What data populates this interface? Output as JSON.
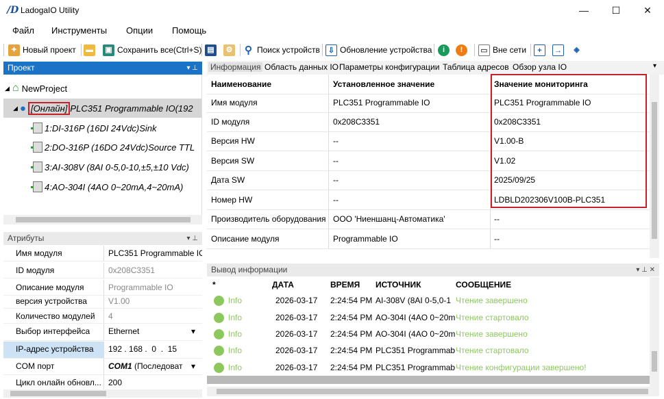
{
  "window": {
    "title": "LadogaIO Utility",
    "minimize": "—",
    "maximize": "☐",
    "close": "✕"
  },
  "menu": [
    "Файл",
    "Инструменты",
    "Опции",
    "Помощь"
  ],
  "toolbar": {
    "new_project": "Новый проект",
    "save_all": "Сохранить все(Ctrl+S)",
    "search_devices": "Поиск устройств",
    "update_device": "Обновление устройства",
    "offline": "Вне сети"
  },
  "project_panel": {
    "title": "Проект",
    "root": "NewProject",
    "plc_online": "[Онлайн]",
    "plc_name": "PLC351 Programmable IO(192",
    "modules": [
      "1:DI-316P (16DI 24Vdc)Sink",
      "2:DO-316P (16DO 24Vdc)Source TTL",
      "3:AI-308V (8AI 0-5,0-10,±5,±10 Vdc)",
      "4:AO-304I (4AO 0~20mA,4~20mA)"
    ]
  },
  "attributes_panel": {
    "title": "Атрибуты",
    "rows": [
      {
        "key": "Имя модуля",
        "value": "PLC351 Programmable IO"
      },
      {
        "key": "ID модуля",
        "value": "0x208C3351"
      },
      {
        "key": "Описание модуля",
        "value": "Programmable IO"
      },
      {
        "key": "версия устройства",
        "value": "V1.00"
      },
      {
        "key": "Количество модулей",
        "value": "4"
      },
      {
        "key": "Выбор интерфейса",
        "value": "Ethernet"
      },
      {
        "key": "IP-адрес устройства",
        "value": "192 . 168 .  0  .  15"
      },
      {
        "key": "COM порт",
        "value_bold": "COM1",
        "value": "(Последоват"
      },
      {
        "key": "Цикл онлайн обновл...",
        "value": "200"
      }
    ]
  },
  "tabs": [
    "Информация",
    "Область данных IO",
    "Параметры конфигурации",
    "Таблица адресов",
    "Обзор узла IO"
  ],
  "info_table": {
    "headers": [
      "Наименование",
      "Установленное значение",
      "Значение мониторинга"
    ],
    "rows": [
      [
        "Имя модуля",
        "PLC351 Programmable IO",
        "PLC351 Programmable IO"
      ],
      [
        "ID модуля",
        "0x208C3351",
        "0x208C3351"
      ],
      [
        "Версия HW",
        "--",
        "V1.00-B"
      ],
      [
        "Версия SW",
        "--",
        "V1.02"
      ],
      [
        "Дата SW",
        "--",
        "2025/09/25"
      ],
      [
        "Номер HW",
        "--",
        "LDBLD202306V100B-PLC351"
      ],
      [
        "Производитель оборудования",
        "ООО 'Ниеншанц-Автоматика'",
        "--"
      ],
      [
        "Описание модуля",
        "Programmable IO",
        "--"
      ]
    ]
  },
  "log_panel": {
    "title": "Вывод информации",
    "headers": [
      "*",
      "ДАТА",
      "ВРЕМЯ",
      "ИСТОЧНИК",
      "СООБЩЕНИЕ"
    ],
    "rows": [
      [
        "Info",
        "2026-03-17",
        "2:24:54 PM",
        "AI-308V (8AI 0-5,0-1",
        "Чтение завершено"
      ],
      [
        "Info",
        "2026-03-17",
        "2:24:54 PM",
        "AO-304I (4AO 0~20m",
        "Чтение стартовало"
      ],
      [
        "Info",
        "2026-03-17",
        "2:24:54 PM",
        "AO-304I (4AO 0~20m",
        "Чтение завершено"
      ],
      [
        "Info",
        "2026-03-17",
        "2:24:54 PM",
        "PLC351 Programmab",
        "Чтение стартовало"
      ],
      [
        "Info",
        "2026-03-17",
        "2:24:54 PM",
        "PLC351 Programmab",
        "Чтение конфигурации завершено!"
      ]
    ]
  },
  "colors": {
    "accent": "#1a73c6",
    "highlight": "#c8202a",
    "info_green": "#8cc85c"
  }
}
